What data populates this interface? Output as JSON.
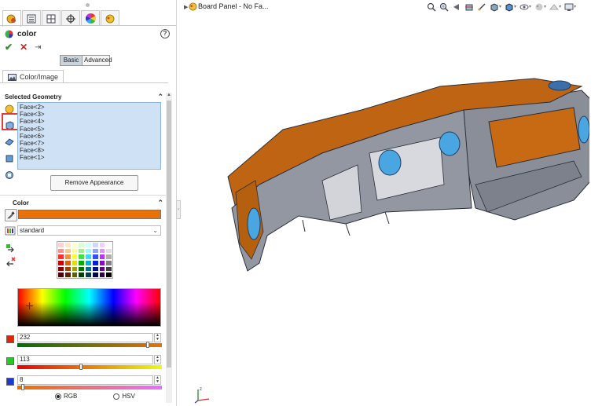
{
  "property_manager": {
    "title": "color",
    "tabs": [
      "appearances-tab",
      "feature-tree-tab",
      "configuration-tab",
      "dimxpert-tab",
      "display-tab",
      "appearance-tab"
    ],
    "mode_basic": "Basic",
    "mode_advanced": "Advanced",
    "subtab_label": "Color/Image",
    "selected_geometry": {
      "header": "Selected Geometry",
      "faces": [
        "Face<2>",
        "Face<3>",
        "Face<4>",
        "Face<5>",
        "Face<6>",
        "Face<7>",
        "Face<8>",
        "Face<1>"
      ],
      "remove_label": "Remove Appearance"
    },
    "color": {
      "header": "Color",
      "current_color": "#e87108",
      "palette_select": "standard",
      "r": "232",
      "g": "113",
      "b": "8",
      "r_level": 0.91,
      "g_level": 0.44,
      "b_level": 0.03,
      "rgb_option": "RGB",
      "hsv_option": "HSV",
      "selected_option": "RGB"
    }
  },
  "viewport": {
    "tree_label": "Board Panel - No Fa..."
  },
  "colors": {
    "accent_orange": "#e87108",
    "selection_blue": "#cfe2f5",
    "highlight_red": "#e23b3b",
    "model_gray": "#8a8e98"
  }
}
